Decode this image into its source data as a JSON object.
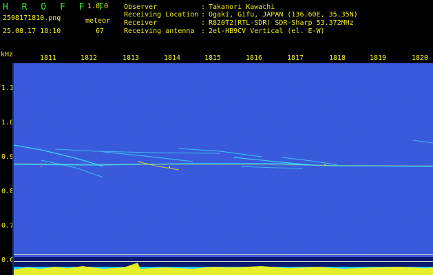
{
  "header": {
    "brand": "H R O F F T",
    "version": "1.0.0",
    "filename": "2508171810.png",
    "detector": "meteor",
    "datetime": "25.08.17 18:10",
    "count": "67"
  },
  "meta": [
    {
      "label": "Observer",
      "value": "Takanori Kawachi"
    },
    {
      "label": "Receiving Location",
      "value": "Ogaki, Gifu, JAPAN (136.60E, 35.35N)"
    },
    {
      "label": "Receiver",
      "value": "R820T2(RTL-SDR) SDR-Sharp 53.372MHz"
    },
    {
      "label": "Receiving antenna",
      "value": "2el-HB9CV Vertical (el. E-W)"
    }
  ],
  "colon": ":",
  "axis": {
    "unit": "kHz",
    "freq_labels": [
      "1.1",
      "1.0",
      "0.9",
      "0.8",
      "0.7",
      "0.6"
    ],
    "time_labels": [
      "1811",
      "1812",
      "1813",
      "1814",
      "1815",
      "1816",
      "1817",
      "1818",
      "1819",
      "1820"
    ]
  },
  "colors": {
    "text_green": "#39e639",
    "text_yellow": "#f0f020",
    "background_noise": "#0a1a6e",
    "signal_cyan": "#40e0ff",
    "signal_yellow": "#f0f020"
  }
}
